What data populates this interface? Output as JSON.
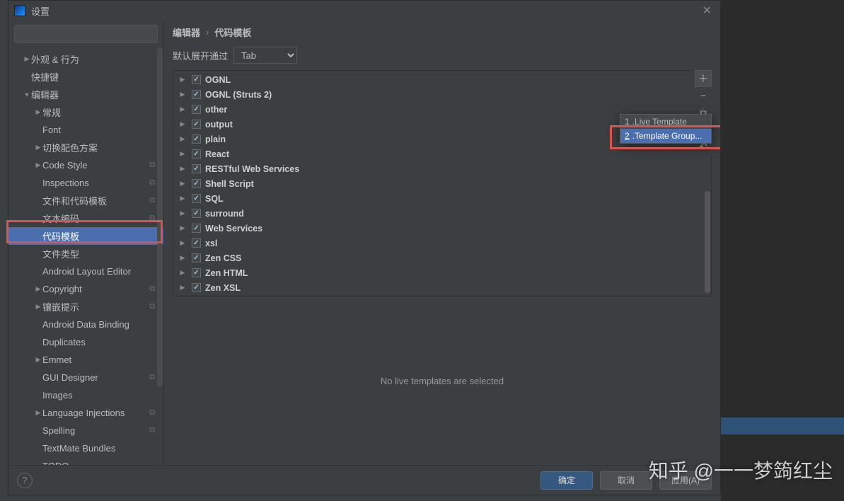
{
  "window": {
    "title": "设置"
  },
  "search": {
    "placeholder": ""
  },
  "sidebar": [
    {
      "label": "外观 & 行为",
      "level": 1,
      "arrow": "▶",
      "badge": ""
    },
    {
      "label": "快捷键",
      "level": 1,
      "arrow": "",
      "badge": ""
    },
    {
      "label": "编辑器",
      "level": 1,
      "arrow": "▼",
      "badge": ""
    },
    {
      "label": "常规",
      "level": 2,
      "arrow": "▶",
      "badge": ""
    },
    {
      "label": "Font",
      "level": 2,
      "arrow": "",
      "badge": ""
    },
    {
      "label": "切换配色方案",
      "level": 2,
      "arrow": "▶",
      "badge": ""
    },
    {
      "label": "Code Style",
      "level": 2,
      "arrow": "▶",
      "badge": "⧉"
    },
    {
      "label": "Inspections",
      "level": 2,
      "arrow": "",
      "badge": "⧉"
    },
    {
      "label": "文件和代码模板",
      "level": 2,
      "arrow": "",
      "badge": "⧉"
    },
    {
      "label": "文本编码",
      "level": 2,
      "arrow": "",
      "badge": "⧉"
    },
    {
      "label": "代码模板",
      "level": 2,
      "arrow": "",
      "badge": "",
      "selected": true
    },
    {
      "label": "文件类型",
      "level": 2,
      "arrow": "",
      "badge": ""
    },
    {
      "label": "Android Layout Editor",
      "level": 2,
      "arrow": "",
      "badge": ""
    },
    {
      "label": "Copyright",
      "level": 2,
      "arrow": "▶",
      "badge": "⧉"
    },
    {
      "label": "镶嵌提示",
      "level": 2,
      "arrow": "▶",
      "badge": "⧉"
    },
    {
      "label": "Android Data Binding",
      "level": 2,
      "arrow": "",
      "badge": ""
    },
    {
      "label": "Duplicates",
      "level": 2,
      "arrow": "",
      "badge": ""
    },
    {
      "label": "Emmet",
      "level": 2,
      "arrow": "▶",
      "badge": ""
    },
    {
      "label": "GUI Designer",
      "level": 2,
      "arrow": "",
      "badge": "⧉"
    },
    {
      "label": "Images",
      "level": 2,
      "arrow": "",
      "badge": ""
    },
    {
      "label": "Language Injections",
      "level": 2,
      "arrow": "▶",
      "badge": "⧉"
    },
    {
      "label": "Spelling",
      "level": 2,
      "arrow": "",
      "badge": "⧉"
    },
    {
      "label": "TextMate Bundles",
      "level": 2,
      "arrow": "",
      "badge": ""
    },
    {
      "label": "TODO",
      "level": 2,
      "arrow": "",
      "badge": ""
    }
  ],
  "breadcrumb": {
    "a": "编辑器",
    "b": "代码模板"
  },
  "expand": {
    "label": "默认展开通过",
    "value": "Tab"
  },
  "groups": [
    "OGNL",
    "OGNL (Struts 2)",
    "other",
    "output",
    "plain",
    "React",
    "RESTful Web Services",
    "Shell Script",
    "SQL",
    "surround",
    "Web Services",
    "xsl",
    "Zen CSS",
    "Zen HTML",
    "Zen XSL"
  ],
  "popup": {
    "items": [
      {
        "num": "1",
        "label": "Live Template"
      },
      {
        "num": "2",
        "label": "Template Group...",
        "selected": true
      }
    ]
  },
  "detail": {
    "empty": "No live templates are selected"
  },
  "buttons": {
    "ok": "确定",
    "cancel": "取消",
    "apply": "应用(A)"
  },
  "watermark": "知乎 @一一梦䈮红尘"
}
